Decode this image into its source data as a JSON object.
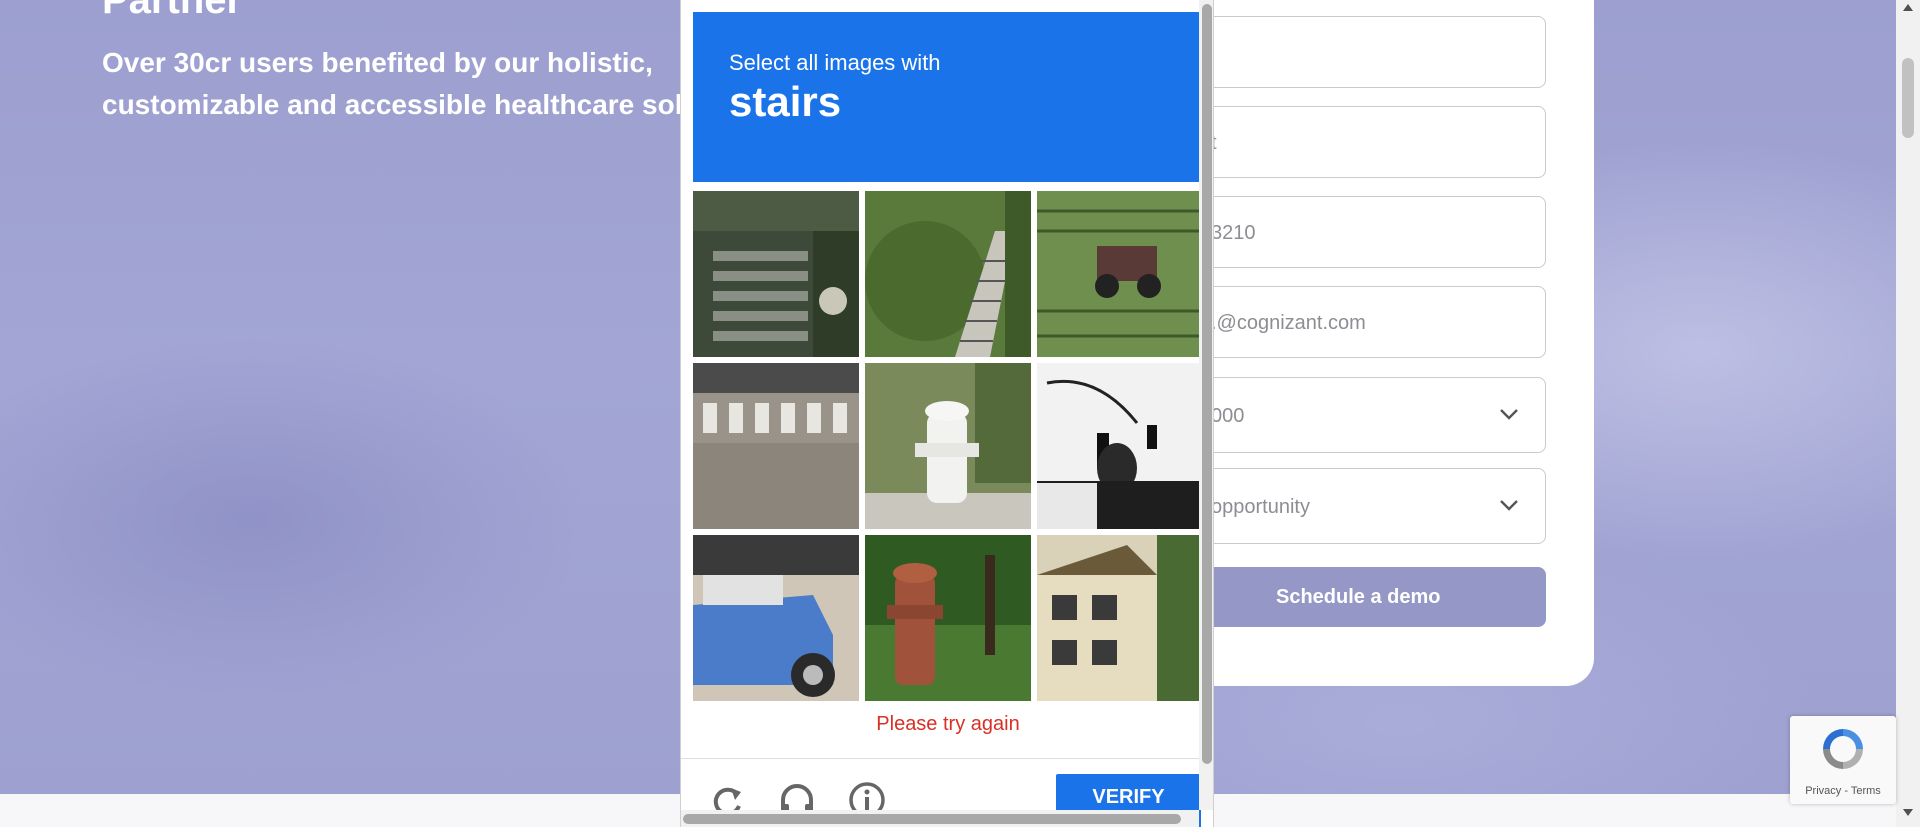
{
  "hero": {
    "title": "Partner",
    "subtitle_line1": "Over 30cr users benefited by our holistic,",
    "subtitle_line2": "customizable and accessible healthcare solu"
  },
  "form": {
    "fields": [
      {
        "value": ""
      },
      {
        "value": "t"
      },
      {
        "value": "3210"
      },
      {
        "value": ".@cognizant.com"
      },
      {
        "value": "000"
      },
      {
        "value": "opportunity"
      }
    ],
    "submit_label": "Schedule a demo"
  },
  "captcha": {
    "instruction": "Select all images with",
    "keyword": "stairs",
    "tiles": [
      "stairs-tile",
      "garden-stairs-tile",
      "tractor-field-tile",
      "crosswalk-tile",
      "fire-hydrant-tile",
      "traffic-light-tile",
      "car-tile",
      "red-hydrant-tile",
      "house-tile"
    ],
    "error": "Please try again",
    "verify_label": "VERIFY",
    "colors": {
      "header": "#1a73e8",
      "error": "#d93025"
    }
  },
  "badge": {
    "terms": "Privacy - Terms"
  },
  "colors": {
    "hero_bg": "#a3a6d4",
    "button": "#9597c7"
  }
}
